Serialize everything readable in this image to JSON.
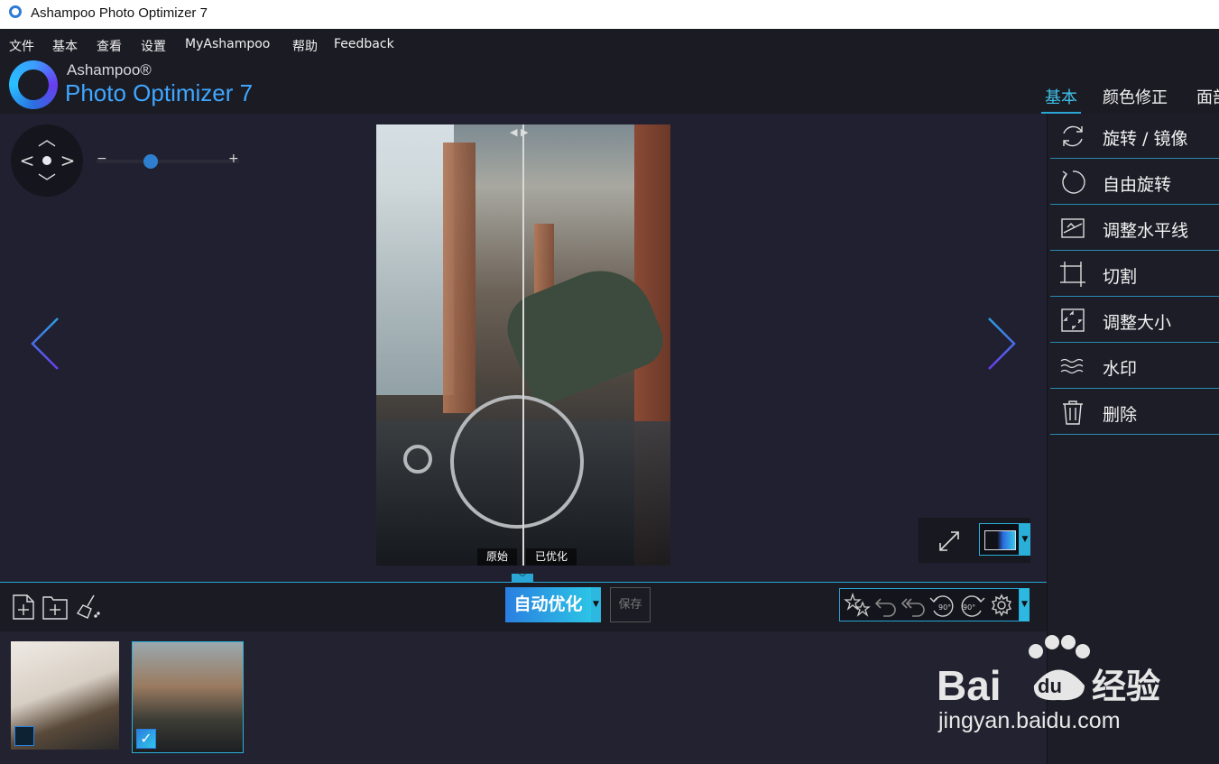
{
  "window": {
    "title": "Ashampoo Photo Optimizer 7"
  },
  "menu": {
    "items": [
      "文件",
      "基本",
      "查看",
      "设置",
      "MyAshampoo",
      "帮助",
      "Feedback"
    ]
  },
  "brand": {
    "small": "Ashampoo®",
    "big": "Photo Optimizer 7"
  },
  "tabs": {
    "items": [
      "基本",
      "颜色修正",
      "面部"
    ],
    "active": "基本"
  },
  "zoom": {
    "minus": "−",
    "plus": "+",
    "level": 0.35
  },
  "compare": {
    "original_label": "原始",
    "optimized_label": "已优化"
  },
  "toolbar": {
    "auto_optimize": "自动优化",
    "save": "保存"
  },
  "sidebar": {
    "items": [
      {
        "label": "旋转 / 镜像",
        "icon": "rotate-mirror-icon"
      },
      {
        "label": "自由旋转",
        "icon": "free-rotate-icon"
      },
      {
        "label": "调整水平线",
        "icon": "horizon-icon"
      },
      {
        "label": "切割",
        "icon": "crop-icon"
      },
      {
        "label": "调整大小",
        "icon": "resize-icon"
      },
      {
        "label": "水印",
        "icon": "watermark-icon"
      },
      {
        "label": "删除",
        "icon": "trash-icon"
      }
    ]
  },
  "history": {
    "rotate_left": "90°",
    "rotate_right": "90°"
  },
  "filmstrip": {
    "thumbs": [
      {
        "selected": false
      },
      {
        "selected": true,
        "check": "✓"
      }
    ]
  },
  "watermark": {
    "logo": "Bai du 经验",
    "url": "jingyan.baidu.com"
  },
  "colors": {
    "accent": "#2aa7d6",
    "brand_blue": "#3fa7ff",
    "background": "#1d1d28"
  }
}
